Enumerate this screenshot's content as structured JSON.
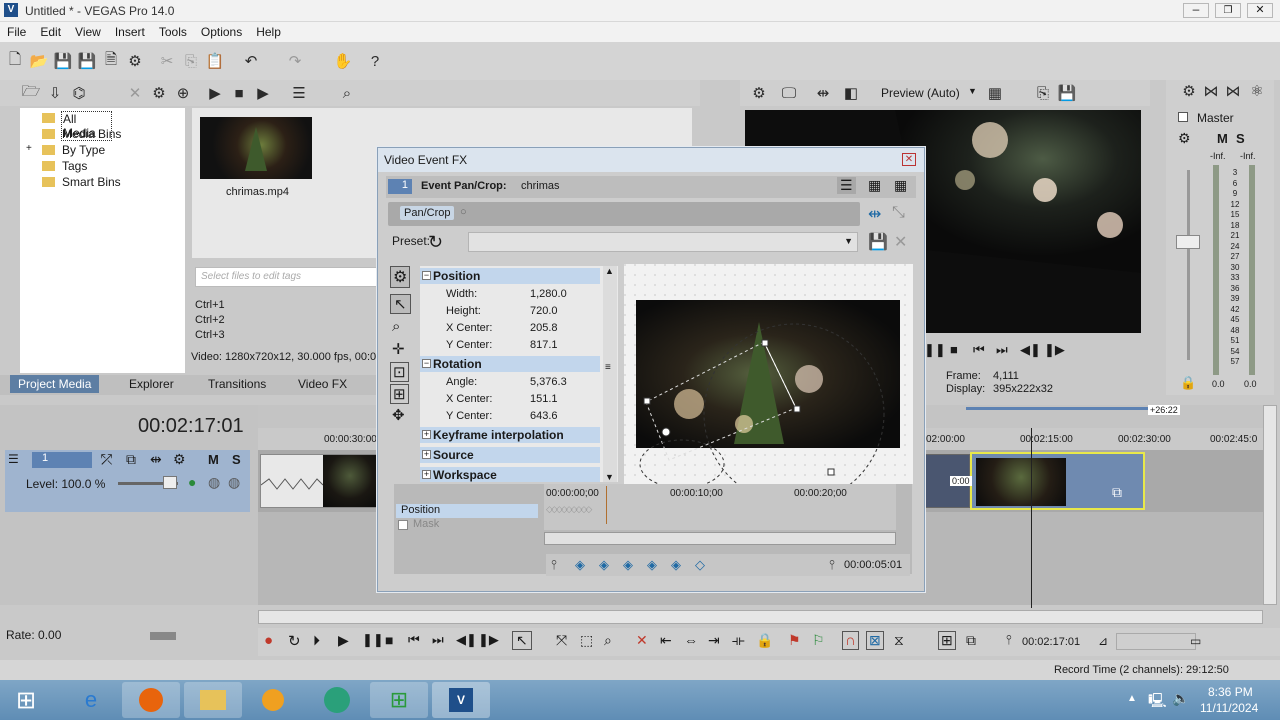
{
  "window": {
    "title": "Untitled * - VEGAS Pro 14.0"
  },
  "menu": [
    "File",
    "Edit",
    "View",
    "Insert",
    "Tools",
    "Options",
    "Help"
  ],
  "explorer": {
    "items": [
      {
        "label": "All Media",
        "selected": true
      },
      {
        "label": "Media Bins"
      },
      {
        "label": "By Type"
      },
      {
        "label": "Tags"
      },
      {
        "label": "Smart Bins"
      }
    ]
  },
  "media": {
    "file_name": "chrimas.mp4",
    "tags_placeholder": "Select files to edit tags",
    "shortcuts": [
      "Ctrl+1",
      "Ctrl+2",
      "Ctrl+3"
    ],
    "video_info": "Video: 1280x720x12, 30.000 fps, 00:0"
  },
  "tabs": [
    "Project Media",
    "Explorer",
    "Transitions",
    "Video FX"
  ],
  "preview": {
    "mode": "Preview (Auto)",
    "frame_label": "Frame:",
    "frame_value": "4,111",
    "display_label": "Display:",
    "display_value": "395x222x32"
  },
  "master": {
    "title": "Master",
    "m": "M",
    "s": "S",
    "db_left": "-Inf.",
    "db_right": "-Inf.",
    "scale": [
      "3",
      "6",
      "9",
      "12",
      "15",
      "18",
      "21",
      "24",
      "27",
      "30",
      "33",
      "36",
      "39",
      "42",
      "45",
      "48",
      "51",
      "54",
      "57"
    ],
    "bottom_left": "0.0",
    "bottom_right": "0.0"
  },
  "timeline": {
    "timecode": "00:02:17:01",
    "ruler_left": [
      "00:00:30:00"
    ],
    "ruler_right": [
      "02:00:00",
      "00:02:15:00",
      "00:02:30:00",
      "00:02:45:0"
    ],
    "duration_badge": "+26:22",
    "clip_badge": "0:00",
    "track_number": "1",
    "m": "M",
    "s": "S",
    "level": "Level: 100.0 %",
    "rate": "Rate: 0.00",
    "transport_time": "00:02:17:01",
    "record_time": "Record Time (2 channels): 29:12:50"
  },
  "dialog": {
    "title": "Video Event FX",
    "event_label": "Event Pan/Crop:",
    "event_name": "chrimas",
    "event_num": "1",
    "chain_plugin": "Pan/Crop",
    "preset_label": "Preset:",
    "sections": {
      "position": {
        "title": "Position",
        "rows": [
          {
            "label": "Width:",
            "value": "1,280.0"
          },
          {
            "label": "Height:",
            "value": "720.0"
          },
          {
            "label": "X Center:",
            "value": "205.8"
          },
          {
            "label": "Y Center:",
            "value": "817.1"
          }
        ]
      },
      "rotation": {
        "title": "Rotation",
        "rows": [
          {
            "label": "Angle:",
            "value": "5,376.3"
          },
          {
            "label": "X Center:",
            "value": "151.1"
          },
          {
            "label": "Y Center:",
            "value": "643.6"
          }
        ]
      },
      "keyframe": {
        "title": "Keyframe interpolation"
      },
      "source": {
        "title": "Source"
      },
      "workspace": {
        "title": "Workspace"
      }
    },
    "kf_times": [
      "00:00:00;00",
      "00:00:10;00",
      "00:00:20;00"
    ],
    "kf_track_position": "Position",
    "kf_track_mask": "Mask",
    "kf_end_time": "00:00:05:01"
  },
  "taskbar": {
    "time": "8:36 PM",
    "date": "11/11/2024"
  }
}
